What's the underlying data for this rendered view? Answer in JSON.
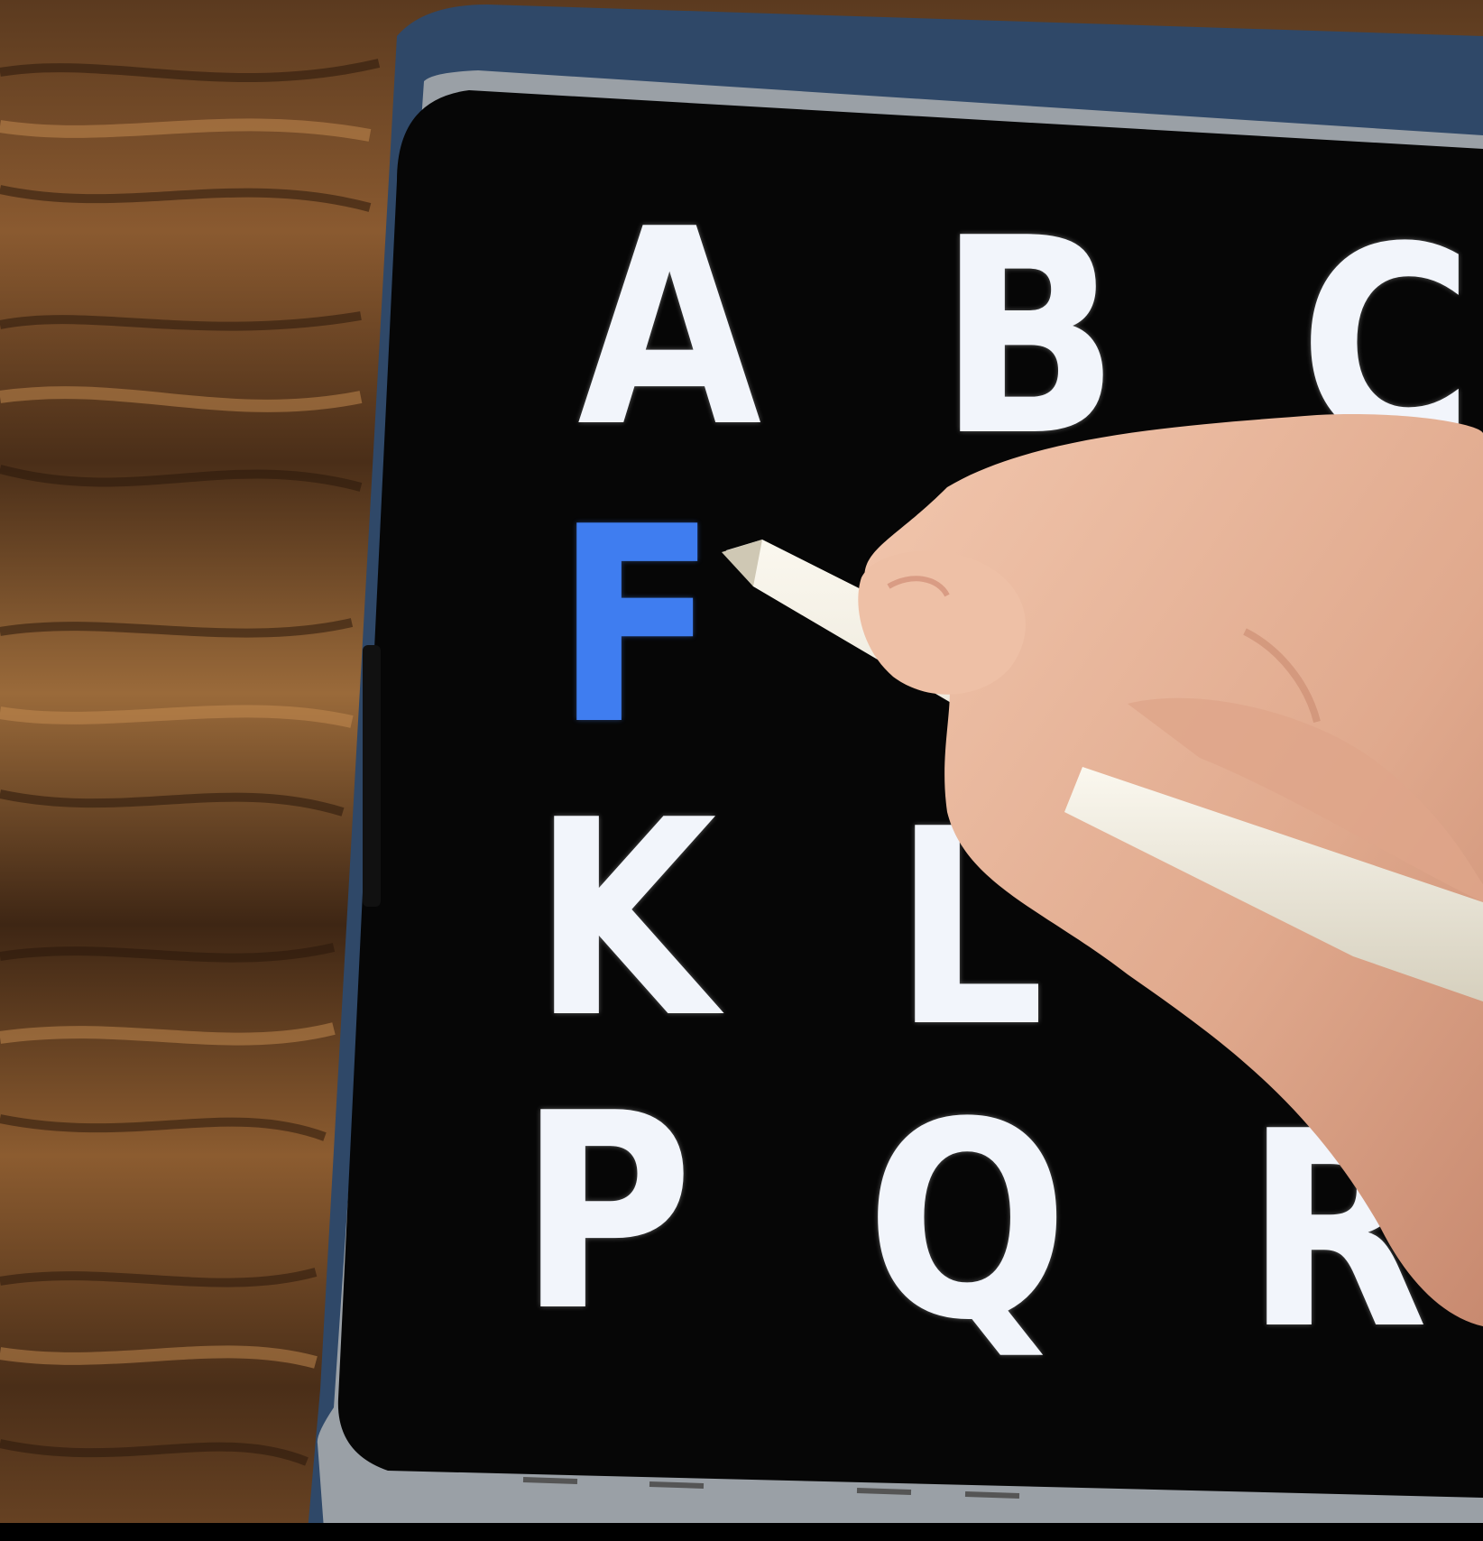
{
  "colors": {
    "wood_dark": "#3b2414",
    "wood_light": "#b07a45",
    "case": "#2f4868",
    "bezel": "#141414",
    "screen": "#060606",
    "letter": "#f2f5fb",
    "letter_active": "#3f7df0",
    "skin": "#e6b8a0",
    "pencil": "#ece8dc"
  },
  "screen": {
    "letters": [
      {
        "char": "A",
        "active": false
      },
      {
        "char": "B",
        "active": false
      },
      {
        "char": "C",
        "active": false
      },
      {
        "char": "F",
        "active": true
      },
      {
        "char": "K",
        "active": false
      },
      {
        "char": "L",
        "active": false
      },
      {
        "char": "P",
        "active": false
      },
      {
        "char": "Q",
        "active": false
      },
      {
        "char": "R",
        "active": false
      }
    ]
  }
}
